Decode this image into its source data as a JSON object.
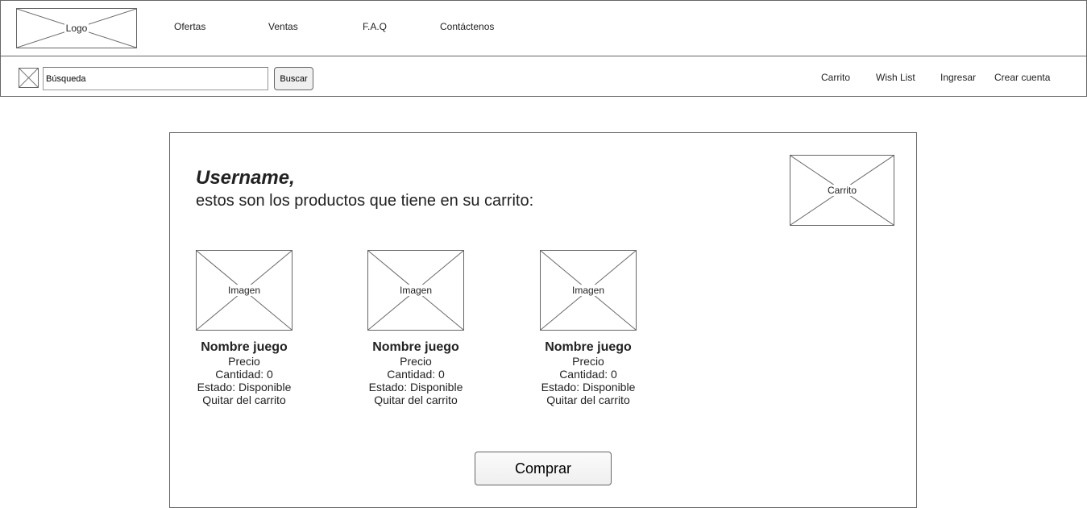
{
  "header": {
    "logo_label": "Logo",
    "nav": [
      "Ofertas",
      "Ventas",
      "F.A.Q",
      "Contáctenos"
    ]
  },
  "search": {
    "value": "Búsqueda",
    "button_label": "Buscar"
  },
  "user_links": [
    "Carrito",
    "Wish List",
    "Ingresar",
    "Crear cuenta"
  ],
  "main": {
    "username": "Username,",
    "subtitle": "estos son los productos que tiene en su carrito:",
    "cart_image_label": "Carrito",
    "products": [
      {
        "image_label": "Imagen",
        "name": "Nombre juego",
        "price": "Precio",
        "quantity": "Cantidad: 0",
        "status": "Estado: Disponible",
        "remove": "Quitar del carrito"
      },
      {
        "image_label": "Imagen",
        "name": "Nombre juego",
        "price": "Precio",
        "quantity": "Cantidad: 0",
        "status": "Estado: Disponible",
        "remove": "Quitar del carrito"
      },
      {
        "image_label": "Imagen",
        "name": "Nombre juego",
        "price": "Precio",
        "quantity": "Cantidad: 0",
        "status": "Estado: Disponible",
        "remove": "Quitar del carrito"
      }
    ],
    "buy_label": "Comprar"
  }
}
